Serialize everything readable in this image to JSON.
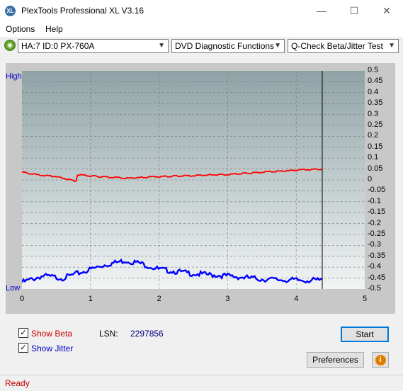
{
  "window": {
    "title": "PlexTools Professional XL V3.16",
    "app_icon_text": "XL"
  },
  "menu": {
    "options": "Options",
    "help": "Help"
  },
  "toolbar": {
    "drive": "HA:7 ID:0  PX-760A",
    "function": "DVD Diagnostic Functions",
    "test": "Q-Check Beta/Jitter Test"
  },
  "chart_data": {
    "type": "line",
    "left_axis": {
      "top_label": "High",
      "bottom_label": "Low"
    },
    "right_axis": {
      "ticks": [
        "0.5",
        "0.45",
        "0.4",
        "0.35",
        "0.3",
        "0.25",
        "0.2",
        "0.15",
        "0.1",
        "0.05",
        "0",
        "-0.05",
        "-0.1",
        "-0.15",
        "-0.2",
        "-0.25",
        "-0.3",
        "-0.35",
        "-0.4",
        "-0.45",
        "-0.5"
      ],
      "ylim": [
        -0.5,
        0.5
      ]
    },
    "x_axis": {
      "ticks": [
        "0",
        "1",
        "2",
        "3",
        "4",
        "5"
      ],
      "xlim": [
        0,
        5
      ]
    },
    "end_marker_x": 4.38,
    "series": [
      {
        "name": "Beta",
        "color": "#ff0000",
        "x": [
          0,
          0.2,
          0.5,
          0.7,
          0.8,
          0.8,
          1.0,
          1.5,
          2.0,
          2.5,
          3.0,
          3.5,
          4.0,
          4.38
        ],
        "y": [
          0.035,
          0.025,
          0.015,
          0.0,
          -0.005,
          0.025,
          0.018,
          0.008,
          0.015,
          0.02,
          0.025,
          0.035,
          0.045,
          0.05
        ]
      },
      {
        "name": "Jitter",
        "color": "#0000ff",
        "x": [
          0,
          0.3,
          0.6,
          0.9,
          1.2,
          1.5,
          1.7,
          2.0,
          2.5,
          3.0,
          3.5,
          4.0,
          4.38
        ],
        "y": [
          -0.47,
          -0.44,
          -0.45,
          -0.42,
          -0.39,
          -0.37,
          -0.38,
          -0.41,
          -0.43,
          -0.44,
          -0.455,
          -0.46,
          -0.46
        ]
      }
    ],
    "grid": true,
    "background_gradient": [
      "#8fa3a6",
      "#f2f4f4"
    ]
  },
  "controls": {
    "show_beta": "Show Beta",
    "show_jitter": "Show Jitter",
    "lsn_label": "LSN:",
    "lsn_value": "2297856",
    "start": "Start",
    "preferences": "Preferences",
    "info_icon": "info-icon"
  },
  "status": {
    "text": "Ready"
  }
}
